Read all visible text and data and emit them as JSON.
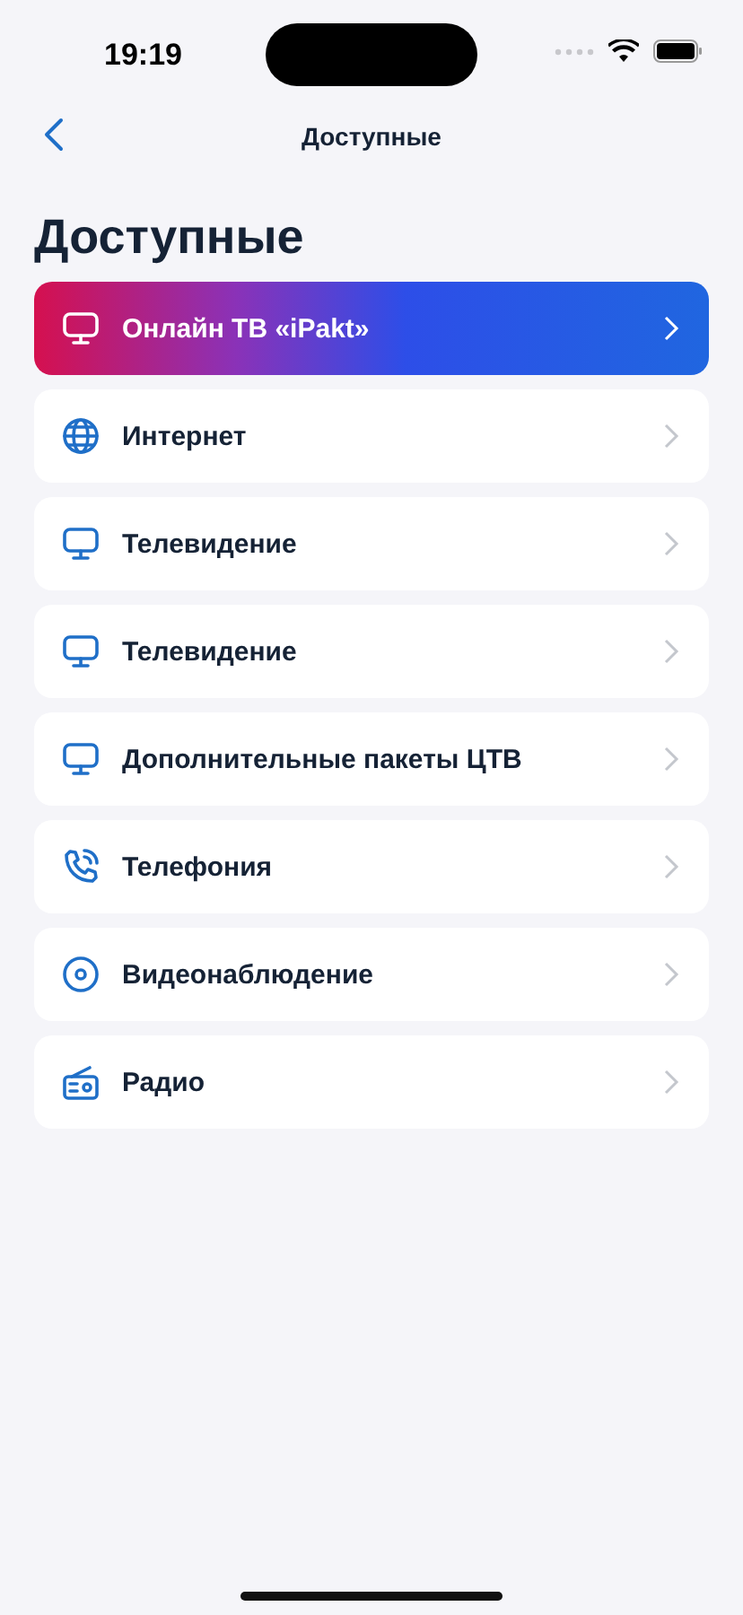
{
  "status_bar": {
    "time": "19:19"
  },
  "nav": {
    "title": "Доступные"
  },
  "title": "Доступные",
  "items": [
    {
      "label": "Онлайн ТВ «iPakt»",
      "kind": "tv",
      "featured": true
    },
    {
      "label": "Интернет",
      "kind": "internet",
      "featured": false
    },
    {
      "label": "Телевидение",
      "kind": "tv",
      "featured": false
    },
    {
      "label": "Телевидение",
      "kind": "tv",
      "featured": false
    },
    {
      "label": "Дополнительные пакеты ЦТВ",
      "kind": "tv",
      "featured": false
    },
    {
      "label": "Телефония",
      "kind": "phone",
      "featured": false
    },
    {
      "label": "Видеонаблюдение",
      "kind": "camera",
      "featured": false
    },
    {
      "label": "Радио",
      "kind": "radio",
      "featured": false
    }
  ]
}
